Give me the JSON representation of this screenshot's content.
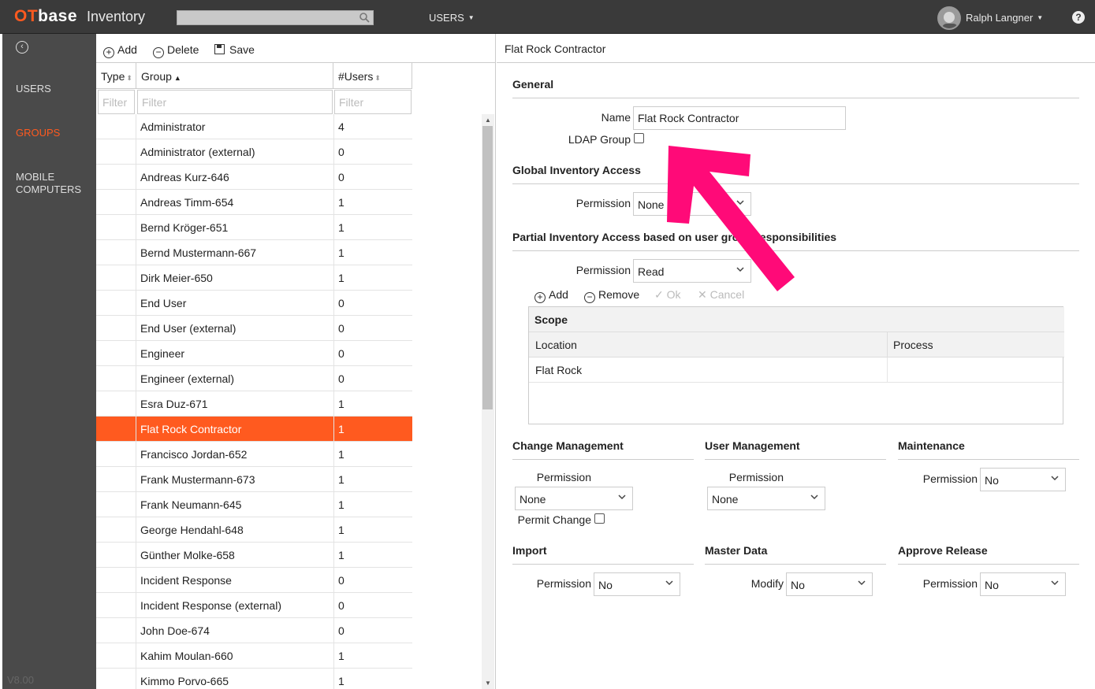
{
  "app": {
    "logo_ot": "OT",
    "logo_base": "base",
    "name": "Inventory"
  },
  "topbar": {
    "menu_label": "USERS",
    "user_name": "Ralph Langner",
    "help": "?"
  },
  "nav": {
    "items": [
      {
        "label": "USERS"
      },
      {
        "label": "GROUPS"
      },
      {
        "label": "MOBILE"
      },
      {
        "label": "COMPUTERS"
      }
    ],
    "version": "V8.00"
  },
  "toolbar": {
    "add_label": "Add",
    "delete_label": "Delete",
    "save_label": "Save"
  },
  "grid": {
    "columns": {
      "type": "Type",
      "group": "Group",
      "users": "#Users"
    },
    "filter_placeholder": "Filter",
    "rows": [
      {
        "group": "Administrator",
        "users": "4"
      },
      {
        "group": "Administrator (external)",
        "users": "0"
      },
      {
        "group": "Andreas Kurz-646",
        "users": "0"
      },
      {
        "group": "Andreas Timm-654",
        "users": "1"
      },
      {
        "group": "Bernd Kröger-651",
        "users": "1"
      },
      {
        "group": "Bernd Mustermann-667",
        "users": "1"
      },
      {
        "group": "Dirk Meier-650",
        "users": "1"
      },
      {
        "group": "End User",
        "users": "0"
      },
      {
        "group": "End User (external)",
        "users": "0"
      },
      {
        "group": "Engineer",
        "users": "0"
      },
      {
        "group": "Engineer (external)",
        "users": "0"
      },
      {
        "group": "Esra Duz-671",
        "users": "1"
      },
      {
        "group": "Flat Rock Contractor",
        "users": "1"
      },
      {
        "group": "Francisco Jordan-652",
        "users": "1"
      },
      {
        "group": "Frank Mustermann-673",
        "users": "1"
      },
      {
        "group": "Frank Neumann-645",
        "users": "1"
      },
      {
        "group": "George Hendahl-648",
        "users": "1"
      },
      {
        "group": "Günther Molke-658",
        "users": "1"
      },
      {
        "group": "Incident Response",
        "users": "0"
      },
      {
        "group": "Incident Response (external)",
        "users": "0"
      },
      {
        "group": "John Doe-674",
        "users": "0"
      },
      {
        "group": "Kahim Moulan-660",
        "users": "1"
      },
      {
        "group": "Kimmo Porvo-665",
        "users": "1"
      }
    ],
    "selected_index": 12
  },
  "detail": {
    "title": "Flat Rock Contractor",
    "general": {
      "heading": "General",
      "name_label": "Name",
      "name_value": "Flat Rock Contractor",
      "ldap_label": "LDAP Group"
    },
    "global": {
      "heading": "Global Inventory Access",
      "perm_label": "Permission",
      "perm_value": "None"
    },
    "partial": {
      "heading": "Partial Inventory Access based on user group responsibilities",
      "perm_label": "Permission",
      "perm_value": "Read",
      "add_label": "Add",
      "remove_label": "Remove",
      "ok_label": "Ok",
      "cancel_label": "Cancel",
      "scope_heading": "Scope",
      "col_location": "Location",
      "col_process": "Process",
      "rows": [
        {
          "location": "Flat Rock",
          "process": ""
        }
      ]
    },
    "change_mgmt": {
      "heading": "Change Management",
      "perm_label": "Permission",
      "perm_value": "None",
      "permit_change_label": "Permit Change"
    },
    "user_mgmt": {
      "heading": "User Management",
      "perm_label": "Permission",
      "perm_value": "None"
    },
    "maintenance": {
      "heading": "Maintenance",
      "perm_label": "Permission",
      "perm_value": "No"
    },
    "import": {
      "heading": "Import",
      "perm_label": "Permission",
      "perm_value": "No"
    },
    "master_data": {
      "heading": "Master Data",
      "modify_label": "Modify",
      "modify_value": "No"
    },
    "approve_release": {
      "heading": "Approve Release",
      "perm_label": "Permission",
      "perm_value": "No"
    }
  },
  "colors": {
    "accent": "#ff5a1f",
    "topbar": "#3a3a3a",
    "nav": "#4a4a4a",
    "annotation_arrow": "#ff0a78"
  }
}
